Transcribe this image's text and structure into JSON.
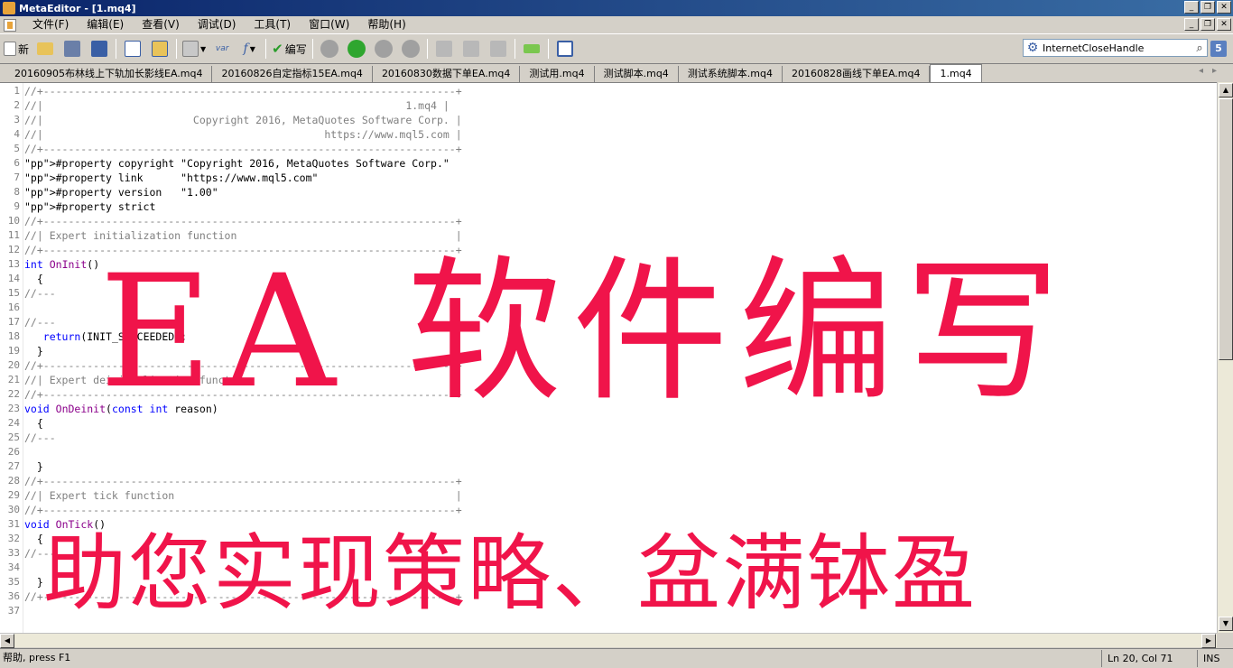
{
  "window": {
    "title": "MetaEditor - [1.mq4]"
  },
  "menu": [
    "文件(F)",
    "编辑(E)",
    "查看(V)",
    "调试(D)",
    "工具(T)",
    "窗口(W)",
    "帮助(H)"
  ],
  "toolbar": {
    "new_label": "新",
    "compile_label": "编写",
    "var_label": "var",
    "func_label": "f"
  },
  "search": {
    "value": "InternetCloseHandle",
    "help_index": "5"
  },
  "tabs": [
    "20160905布林线上下轨加长影线EA.mq4",
    "20160826自定指标15EA.mq4",
    "20160830数据下单EA.mq4",
    "测试用.mq4",
    "测试脚本.mq4",
    "测试系统脚本.mq4",
    "20160828画线下单EA.mq4",
    "1.mq4"
  ],
  "active_tab": "1.mq4",
  "code_lines": [
    "//+------------------------------------------------------------------+",
    "//|                                                          1.mq4 |",
    "//|                        Copyright 2016, MetaQuotes Software Corp. |",
    "//|                                             https://www.mql5.com |",
    "//+------------------------------------------------------------------+",
    "#property copyright \"Copyright 2016, MetaQuotes Software Corp.\"",
    "#property link      \"https://www.mql5.com\"",
    "#property version   \"1.00\"",
    "#property strict",
    "//+------------------------------------------------------------------+",
    "//| Expert initialization function                                   |",
    "//+------------------------------------------------------------------+",
    "int OnInit()",
    "  {",
    "//---",
    "",
    "//---",
    "   return(INIT_SUCCEEDED);",
    "  }",
    "//+------------------------------------------------------------------+",
    "//| Expert deinitialization function                                 |",
    "//+------------------------------------------------------------------+",
    "void OnDeinit(const int reason)",
    "  {",
    "//---",
    "",
    "  }",
    "//+------------------------------------------------------------------+",
    "//| Expert tick function                                             |",
    "//+------------------------------------------------------------------+",
    "void OnTick()",
    "  {",
    "//---",
    "",
    "  }",
    "//+------------------------------------------------------------------+",
    ""
  ],
  "overlay": {
    "headline": "EA 软件编写",
    "slogan": "助您实现策略、盆满钵盈"
  },
  "status": {
    "help": "帮助, press F1",
    "position": "Ln 20, Col 71",
    "mode": "INS"
  },
  "colors": {
    "overlay": "#f0144a",
    "comment": "#808080",
    "keyword": "#0000ff",
    "string": "#008080"
  }
}
